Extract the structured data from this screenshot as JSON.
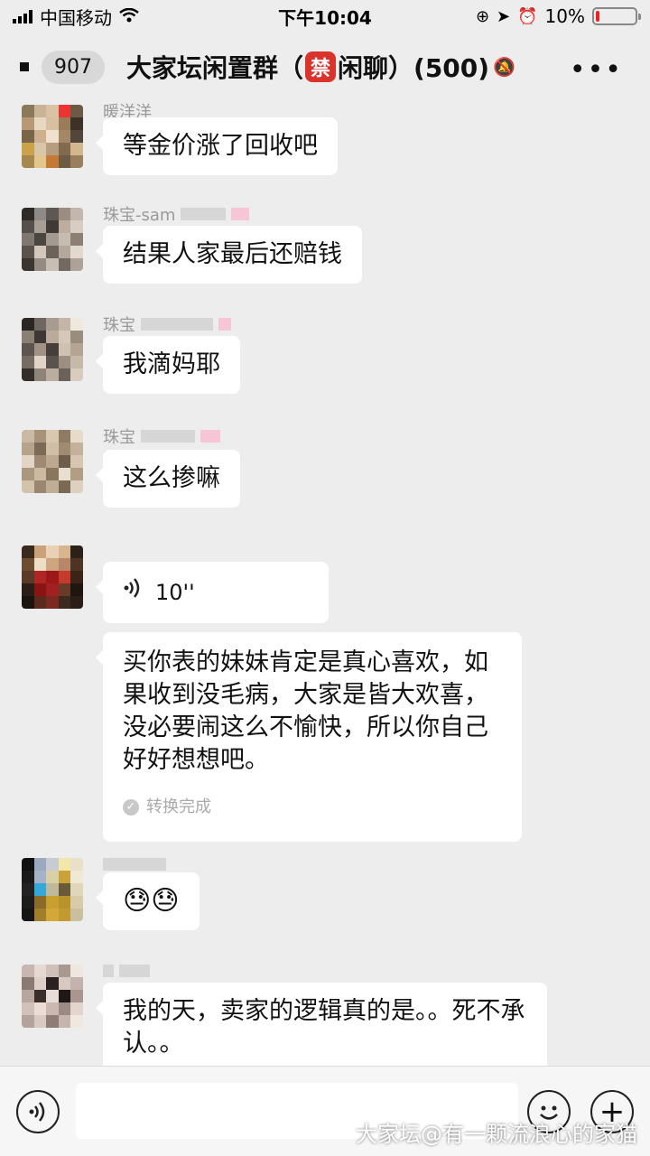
{
  "status_bar": {
    "carrier": "中国移动",
    "time": "下午10:04",
    "battery": "10%",
    "battery_level": 0.1
  },
  "nav": {
    "unread_count": "907",
    "title_before": "大家坛闲置群（",
    "ban_char": "禁",
    "title_after": "闲聊）(500)",
    "more_icon": "more-icon",
    "mute_icon": "mute-icon"
  },
  "messages": [
    {
      "sender": "暖洋洋",
      "text": "等金价涨了回收吧"
    },
    {
      "sender": "珠宝-sam",
      "text": "结果人家最后还赔钱"
    },
    {
      "sender": "珠宝",
      "text": "我滴妈耶"
    },
    {
      "sender": "珠宝",
      "text": "这么掺嘛"
    },
    {
      "sender": "",
      "voice_duration": "10''",
      "transcript": "买你表的妹妹肯定是真心喜欢，如果收到没毛病，大家是皆大欢喜，没必要闹这么不愉快，所以你自己好好想想吧。",
      "transcript_status": "转换完成"
    },
    {
      "sender": "",
      "text": "😓😓"
    },
    {
      "sender": "",
      "text": "我的天，卖家的逻辑真的是。。死不承认。。"
    }
  ],
  "input_bar": {
    "voice_icon": "voice-icon",
    "emoji_icon": "emoji-icon",
    "plus_icon": "plus-icon"
  },
  "watermark": "大家坛@有一颗流浪心的家猫",
  "colors": {
    "background": "#ededed",
    "bubble": "#ffffff",
    "ban_badge": "#d9342b",
    "battery_low": "#ee2222"
  }
}
